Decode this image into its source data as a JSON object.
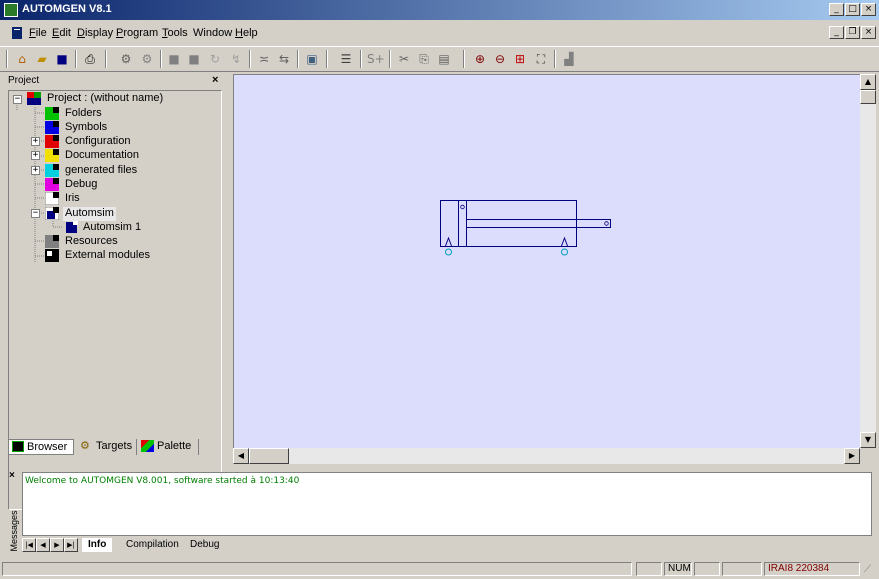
{
  "window": {
    "title": "AUTOMGEN V8.1"
  },
  "menu": [
    {
      "id": "file",
      "u": "F",
      "rest": "ile"
    },
    {
      "id": "edit",
      "u": "E",
      "rest": "dit"
    },
    {
      "id": "display",
      "u": "D",
      "rest": "isplay"
    },
    {
      "id": "program",
      "u": "P",
      "rest": "rogram"
    },
    {
      "id": "tools",
      "u": "T",
      "rest": "ools"
    },
    {
      "id": "window",
      "u": "W",
      "rest": "indow"
    },
    {
      "id": "help",
      "u": "H",
      "rest": "elp"
    }
  ],
  "project_panel": {
    "header": "Project",
    "root": "Project : (without name)",
    "items": [
      "Folders",
      "Symbols",
      "Configuration",
      "Documentation",
      "generated files",
      "Debug",
      "Iris",
      "Automsim"
    ],
    "child": "Automsim 1",
    "items2": [
      "Resources",
      "External modules"
    ]
  },
  "panel_tabs": [
    "Browser",
    "Targets",
    "Palette"
  ],
  "messages": {
    "side_label": "Messages",
    "text": "Welcome to AUTOMGEN V8.001, software started à 10:13:40",
    "tabs": [
      "Info",
      "Compilation",
      "Debug"
    ]
  },
  "status": {
    "num": "NUM",
    "id": "IRAI8 220384"
  },
  "colors": {
    "canvas": "#dcdcfc",
    "title_start": "#0a246a",
    "title_end": "#a6caf0",
    "message_text": "#008000",
    "status_id": "#800000"
  }
}
